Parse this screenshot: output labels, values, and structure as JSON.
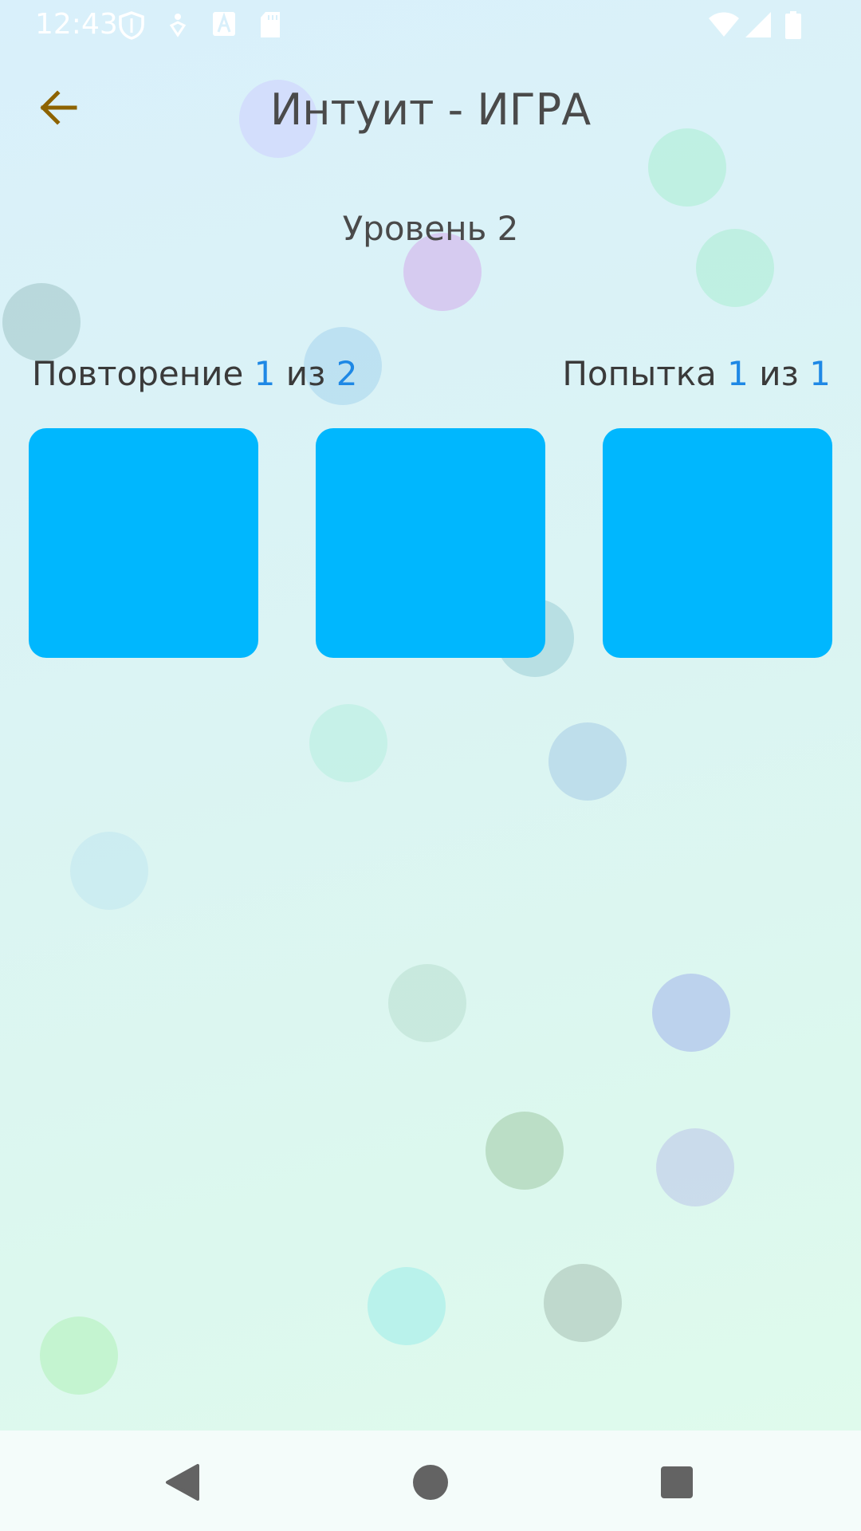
{
  "status_bar": {
    "time": "12:43",
    "icons": [
      "shield-icon",
      "accessibility-icon",
      "font-a-icon",
      "sd-card-icon",
      "wifi-icon",
      "signal-icon",
      "battery-icon"
    ]
  },
  "header": {
    "back_icon": "arrow-left-icon",
    "title": "Интуит - ИГРА"
  },
  "level": {
    "label": "Уровень 2"
  },
  "repeat_counter": {
    "label": "Повторение",
    "current": "1",
    "sep": "из",
    "total": "2"
  },
  "attempt_counter": {
    "label": "Попытка",
    "current": "1",
    "sep": "из",
    "total": "1"
  },
  "tiles": [
    {
      "color": "#00b7fe"
    },
    {
      "color": "#00b7fe"
    },
    {
      "color": "#00b7fe"
    }
  ],
  "colors": {
    "accent": "#1e88e5",
    "tile": "#00b7fe",
    "back_arrow": "#8d6300",
    "title_text": "#4a4a4a"
  },
  "nav_bar": {
    "icons": [
      "back-triangle-icon",
      "home-circle-icon",
      "recents-square-icon"
    ]
  }
}
